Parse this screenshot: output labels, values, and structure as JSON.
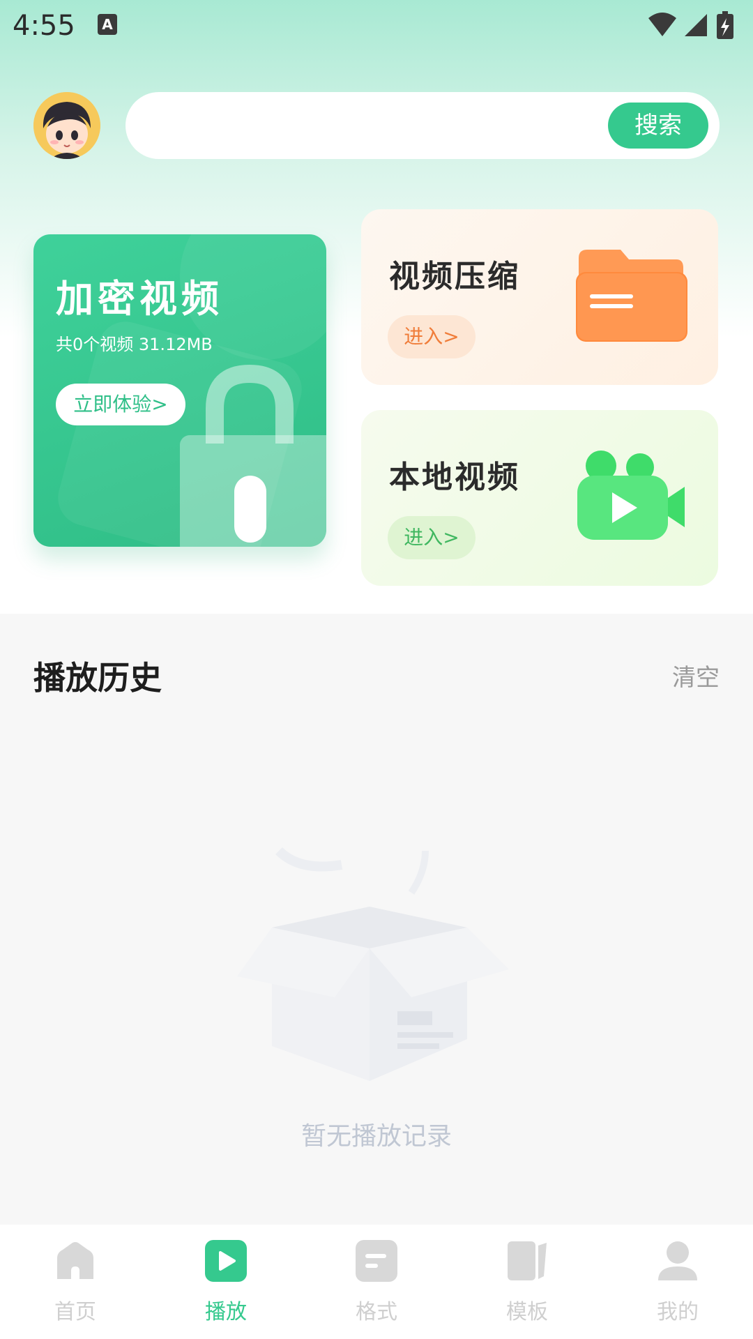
{
  "status_bar": {
    "time": "4:55",
    "notification_icon": "a-icon",
    "icons": [
      "wifi-icon",
      "signal-icon",
      "battery-icon"
    ]
  },
  "header": {
    "avatar": "avatar",
    "search": {
      "placeholder": "",
      "button_label": "搜索"
    }
  },
  "cards": {
    "encrypt": {
      "title": "加密视频",
      "subtitle": "共0个视频  31.12MB",
      "button_label": "立即体验>"
    },
    "compress": {
      "title": "视频压缩",
      "button_label": "进入>"
    },
    "local": {
      "title": "本地视频",
      "button_label": "进入>"
    }
  },
  "history": {
    "title": "播放历史",
    "clear_label": "清空",
    "empty_text": "暂无播放记录"
  },
  "tabbar": {
    "items": [
      {
        "label": "首页",
        "icon": "home-icon",
        "active": false
      },
      {
        "label": "播放",
        "icon": "play-icon",
        "active": true
      },
      {
        "label": "格式",
        "icon": "format-icon",
        "active": false
      },
      {
        "label": "模板",
        "icon": "template-icon",
        "active": false
      },
      {
        "label": "我的",
        "icon": "profile-icon",
        "active": false
      }
    ]
  },
  "colors": {
    "accent": "#35c98e",
    "orange": "#f07d3a",
    "inactive": "#cfcfcf"
  }
}
